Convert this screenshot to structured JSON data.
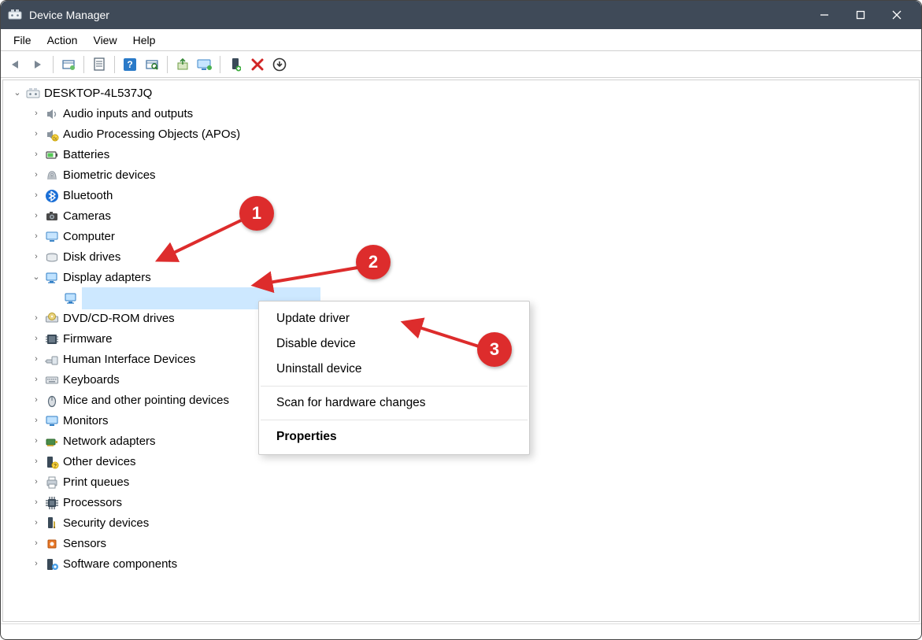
{
  "window": {
    "title": "Device Manager"
  },
  "menu": {
    "file": "File",
    "action": "Action",
    "view": "View",
    "help": "Help"
  },
  "toolbar_icons": {
    "back": "back-arrow-icon",
    "forward": "forward-arrow-icon",
    "show_hidden": "show-hidden-icon",
    "properties": "properties-icon",
    "help": "help-icon",
    "scan": "scan-icon",
    "update": "update-driver-icon",
    "monitor": "monitor-icon",
    "enable": "enable-device-icon",
    "disable": "disable-device-icon",
    "uninstall": "uninstall-icon"
  },
  "tree": {
    "root": {
      "label": "DESKTOP-4L537JQ",
      "expanded": true
    },
    "children": [
      {
        "label": "Audio inputs and outputs",
        "icon": "speaker-icon",
        "expandable": true
      },
      {
        "label": "Audio Processing Objects (APOs)",
        "icon": "speaker-fx-icon",
        "expandable": true
      },
      {
        "label": "Batteries",
        "icon": "battery-icon",
        "expandable": true
      },
      {
        "label": "Biometric devices",
        "icon": "fingerprint-icon",
        "expandable": true
      },
      {
        "label": "Bluetooth",
        "icon": "bluetooth-icon",
        "expandable": true
      },
      {
        "label": "Cameras",
        "icon": "camera-icon",
        "expandable": true
      },
      {
        "label": "Computer",
        "icon": "computer-icon",
        "expandable": true
      },
      {
        "label": "Disk drives",
        "icon": "disk-icon",
        "expandable": true
      },
      {
        "label": "Display adapters",
        "icon": "display-adapter-icon",
        "expandable": true,
        "expanded": true,
        "children": [
          {
            "label": "",
            "icon": "display-adapter-icon",
            "selected": true,
            "redacted": true
          }
        ]
      },
      {
        "label": "DVD/CD-ROM drives",
        "icon": "optical-drive-icon",
        "expandable": true
      },
      {
        "label": "Firmware",
        "icon": "firmware-icon",
        "expandable": true
      },
      {
        "label": "Human Interface Devices",
        "icon": "hid-icon",
        "expandable": true
      },
      {
        "label": "Keyboards",
        "icon": "keyboard-icon",
        "expandable": true
      },
      {
        "label": "Mice and other pointing devices",
        "icon": "mouse-icon",
        "expandable": true
      },
      {
        "label": "Monitors",
        "icon": "monitor-icon",
        "expandable": true
      },
      {
        "label": "Network adapters",
        "icon": "network-adapter-icon",
        "expandable": true
      },
      {
        "label": "Other devices",
        "icon": "other-device-icon",
        "expandable": true
      },
      {
        "label": "Print queues",
        "icon": "printer-icon",
        "expandable": true
      },
      {
        "label": "Processors",
        "icon": "cpu-icon",
        "expandable": true
      },
      {
        "label": "Security devices",
        "icon": "security-icon",
        "expandable": true
      },
      {
        "label": "Sensors",
        "icon": "sensor-icon",
        "expandable": true
      },
      {
        "label": "Software components",
        "icon": "software-component-icon",
        "expandable": true
      }
    ]
  },
  "context_menu": {
    "update": "Update driver",
    "disable": "Disable device",
    "uninstall": "Uninstall device",
    "scan": "Scan for hardware changes",
    "properties": "Properties"
  },
  "annotations": {
    "b1": "1",
    "b2": "2",
    "b3": "3"
  }
}
